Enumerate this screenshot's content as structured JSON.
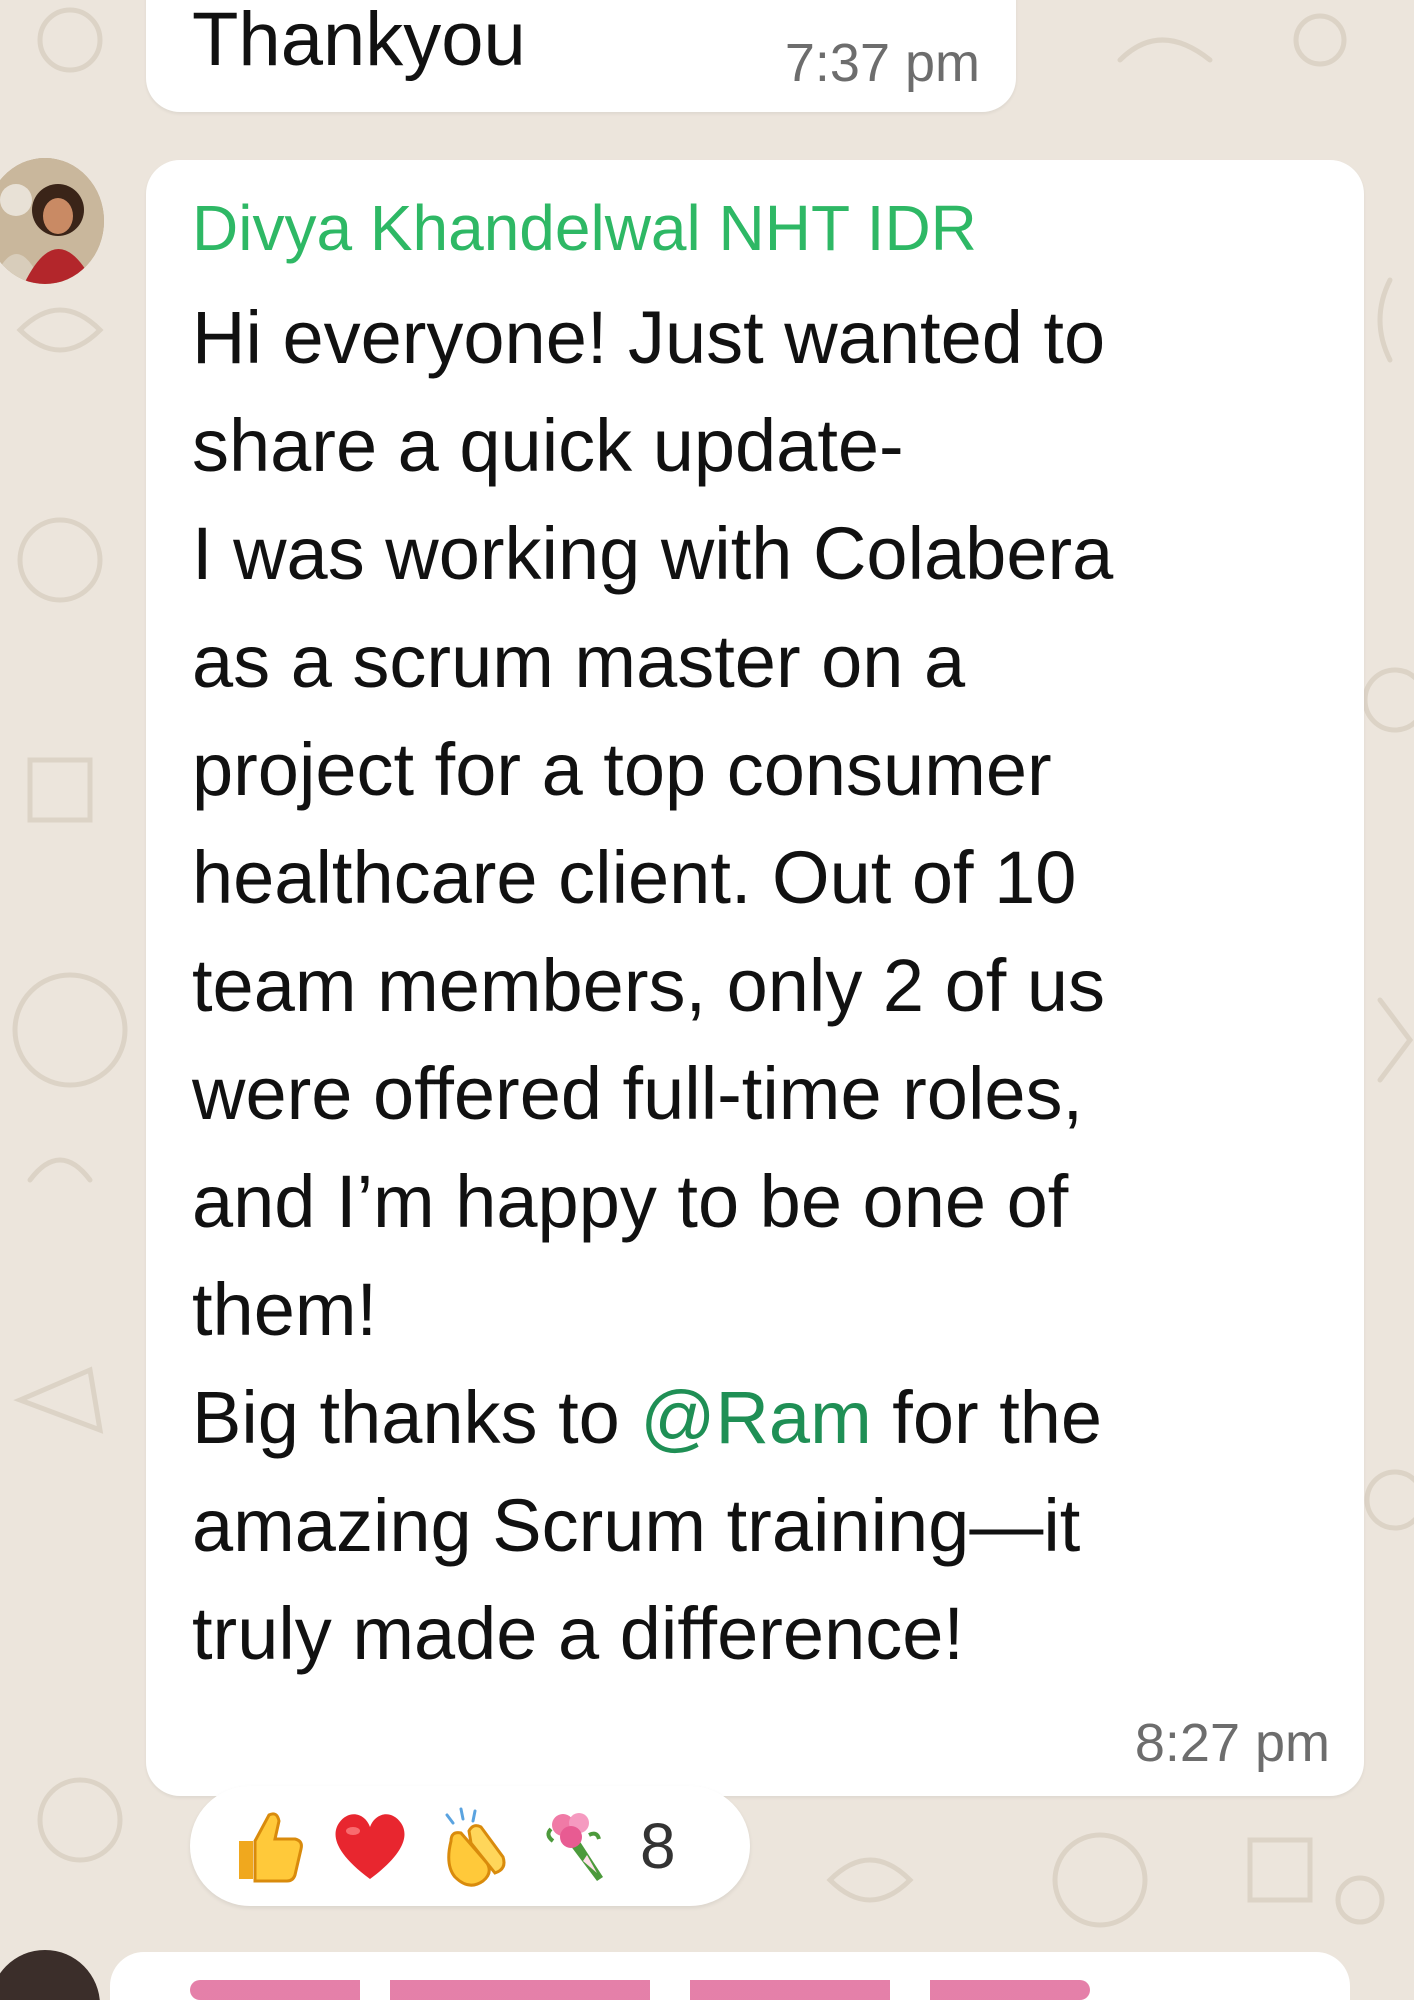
{
  "previous_message": {
    "text": "Thankyou",
    "time": "7:37 pm"
  },
  "message": {
    "sender": "Divya Khandelwal NHT IDR",
    "lines": [
      "Hi everyone! Just wanted to",
      "share a quick update-",
      "I was working with Colabera",
      "as a scrum master on a",
      "project for a top consumer",
      "healthcare client. Out of 10",
      "team members, only 2 of us",
      "were offered full-time roles,",
      "and I’m happy to be one of",
      "them!"
    ],
    "thanks_before": "Big thanks to ",
    "mention": "@Ram",
    "thanks_after": " for the",
    "lines_end": [
      "amazing Scrum training—it",
      "truly made a difference!"
    ],
    "time": "8:27 pm"
  },
  "reactions": {
    "emojis": [
      "thumbs-up",
      "red-heart",
      "clapping-hands",
      "bouquet"
    ],
    "count": "8"
  },
  "colors": {
    "sender": "#2eb865",
    "mention": "#1f8f55",
    "bubble": "#ffffff",
    "chat_background": "#ece5dc",
    "timestamp": "#6d6d6d"
  }
}
